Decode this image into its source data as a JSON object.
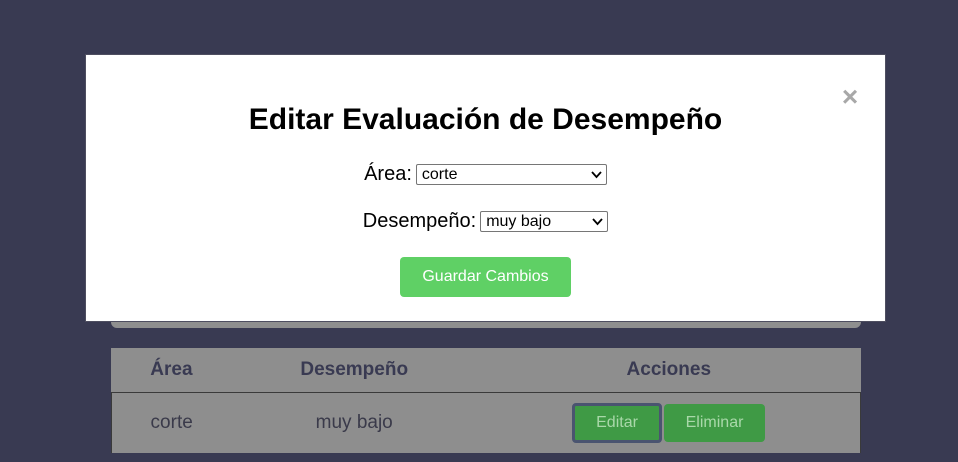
{
  "table": {
    "headers": [
      "Área",
      "Desempeño",
      "Acciones"
    ],
    "rows": [
      {
        "area": "corte",
        "desempeno": "muy bajo",
        "edit_label": "Editar",
        "delete_label": "Eliminar"
      }
    ]
  },
  "modal": {
    "close_glyph": "×",
    "title": "Editar Evaluación de Desempeño",
    "area_label": "Área:",
    "area_value": "corte",
    "desempeno_label": "Desempeño:",
    "desempeno_value": "muy bajo",
    "save_label": "Guardar Cambios"
  },
  "colors": {
    "page_background": "#393a52",
    "save_button": "#5fd065",
    "table_button": "#3f9a45"
  }
}
